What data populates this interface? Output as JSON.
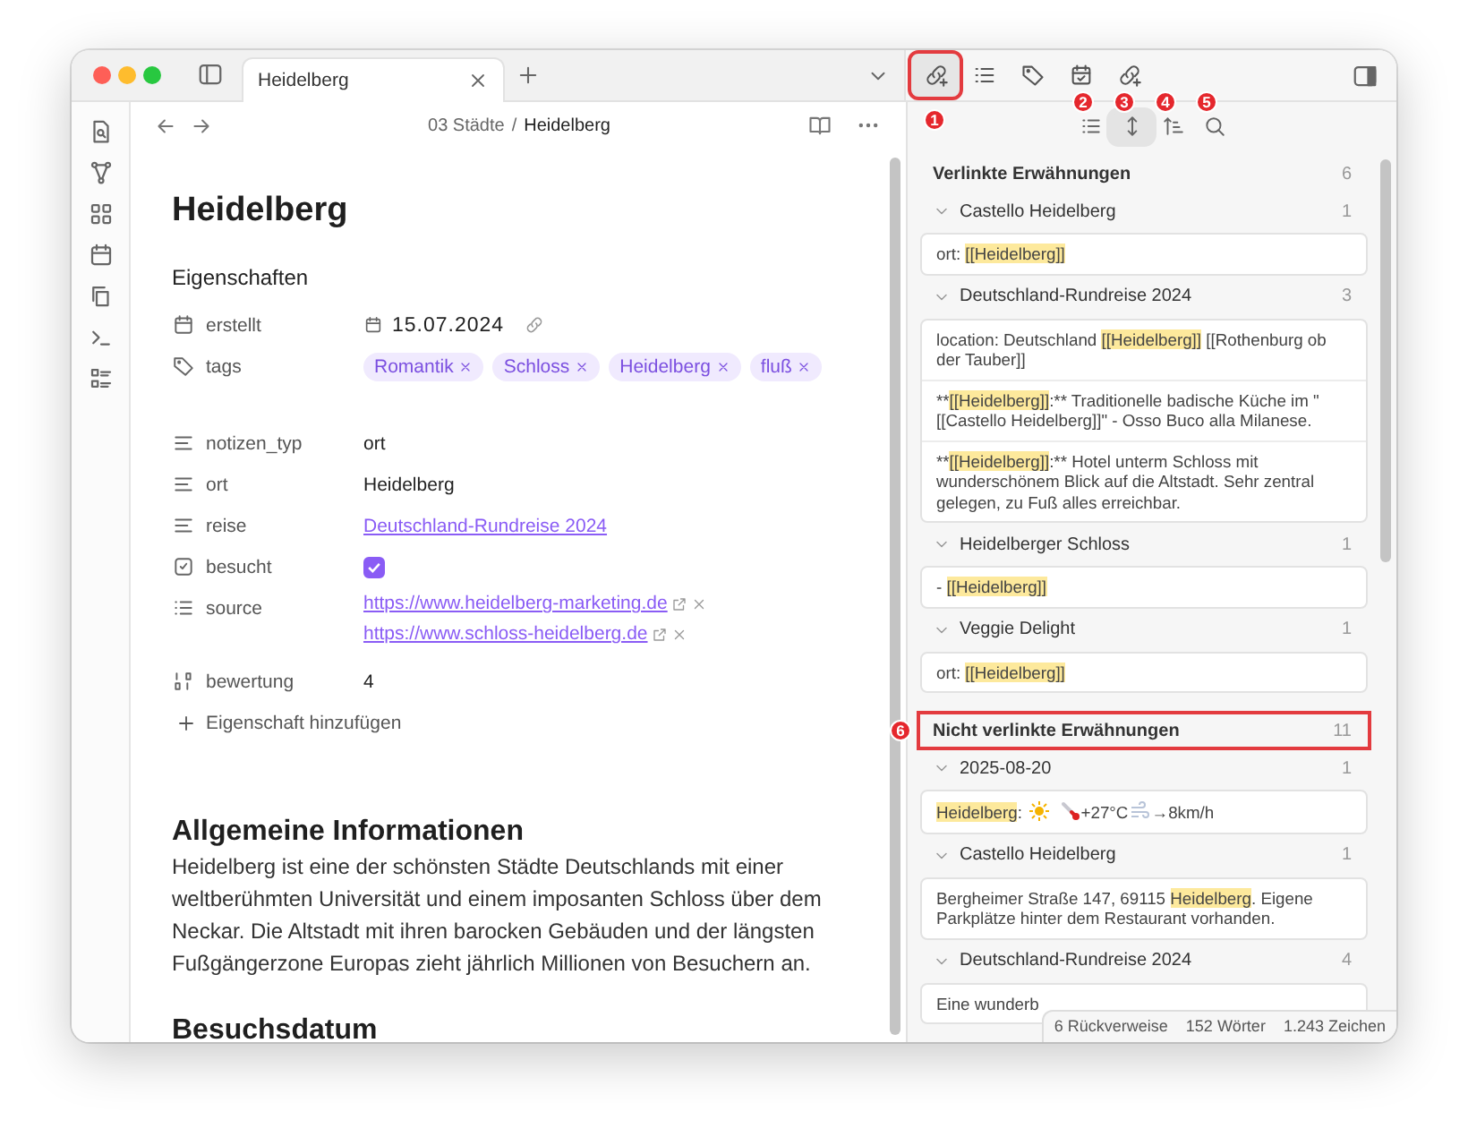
{
  "tab": {
    "title": "Heidelberg",
    "selected": true
  },
  "editor": {
    "breadcrumb": {
      "folder": "03 Städte",
      "separator": "/",
      "note": "Heidelberg"
    },
    "title": "Heidelberg",
    "properties_heading": "Eigenschaften",
    "properties": [
      {
        "kind": "date",
        "label": "erstellt",
        "value": "15.07.2024"
      },
      {
        "kind": "tags",
        "label": "tags",
        "tags": [
          "Romantik",
          "Schloss",
          "Heidelberg",
          "fluß"
        ]
      },
      {
        "kind": "text",
        "label": "notizen_typ",
        "value": "ort"
      },
      {
        "kind": "text",
        "label": "ort",
        "value": "Heidelberg"
      },
      {
        "kind": "link",
        "label": "reise",
        "value": "Deutschland-Rundreise 2024"
      },
      {
        "kind": "checkbox",
        "label": "besucht",
        "checked": true
      },
      {
        "kind": "urls",
        "label": "source",
        "urls": [
          "https://www.heidelberg-marketing.de",
          "https://www.schloss-heidelberg.de"
        ]
      },
      {
        "kind": "number",
        "label": "bewertung",
        "value": "4"
      }
    ],
    "add_property": "Eigenschaft hinzufügen",
    "sections": [
      {
        "heading": "Allgemeine Informationen",
        "body": "Heidelberg ist eine der schönsten Städte Deutschlands mit einer weltberühmten Universität und einem imposanten Schloss über dem Neckar. Die Altstadt mit ihren barocken Gebäuden und der längsten Fußgängerzone Europas zieht jährlich Millionen von Besuchern an."
      },
      {
        "heading": "Besuchsdatum"
      }
    ]
  },
  "panel": {
    "view_tabs": [
      {
        "selected": true,
        "badge": "1",
        "outlined": true
      },
      {
        "selected": false
      },
      {
        "selected": false
      },
      {
        "selected": false
      },
      {
        "selected": false
      }
    ],
    "toolbar": [
      {
        "selected": false,
        "badge": "2"
      },
      {
        "selected": true,
        "badge": "3"
      },
      {
        "selected": false,
        "badge": "4"
      },
      {
        "selected": false,
        "badge": "5"
      }
    ],
    "linked": {
      "title": "Verlinkte Erwähnungen",
      "count": "6",
      "outlined": false,
      "groups": [
        {
          "title": "Castello Heidelberg",
          "count": "1",
          "expanded": true,
          "snippets": [
            [
              {
                "kind": "text",
                "text": "ort: "
              },
              {
                "kind": "highlight",
                "text": "[[Heidelberg]]"
              }
            ]
          ]
        },
        {
          "title": "Deutschland-Rundreise 2024",
          "count": "3",
          "expanded": true,
          "snippets": [
            [
              {
                "kind": "text",
                "text": "location: Deutschland "
              },
              {
                "kind": "highlight",
                "text": "[[Heidelberg]]"
              },
              {
                "kind": "text",
                "text": " [[Rothenburg ob der Tauber]]"
              }
            ],
            [
              {
                "kind": "text",
                "text": "**"
              },
              {
                "kind": "highlight",
                "text": "[[Heidelberg]]"
              },
              {
                "kind": "text",
                "text": ":** Traditionelle badische Küche im \"[[Castello Heidelberg]]\" - Osso Buco alla Milanese."
              }
            ],
            [
              {
                "kind": "text",
                "text": "**"
              },
              {
                "kind": "highlight",
                "text": "[[Heidelberg]]"
              },
              {
                "kind": "text",
                "text": ":** Hotel unterm Schloss mit wunderschönem Blick auf die Altstadt. Sehr zentral gelegen, zu Fuß alles erreichbar."
              }
            ]
          ]
        },
        {
          "title": "Heidelberger Schloss",
          "count": "1",
          "expanded": true,
          "snippets": [
            [
              {
                "kind": "text",
                "text": "- "
              },
              {
                "kind": "highlight",
                "text": "[[Heidelberg]]"
              }
            ]
          ]
        },
        {
          "title": "Veggie Delight",
          "count": "1",
          "expanded": true,
          "snippets": [
            [
              {
                "kind": "text",
                "text": "ort: "
              },
              {
                "kind": "highlight",
                "text": "[[Heidelberg]]"
              }
            ]
          ]
        }
      ]
    },
    "unlinked": {
      "title": "Nicht verlinkte Erwähnungen",
      "count": "11",
      "outlined": true,
      "badge": "6",
      "groups": [
        {
          "title": "2025-08-20",
          "count": "1",
          "expanded": true,
          "snippets": [
            [
              {
                "kind": "highlight",
                "text": "Heidelberg"
              },
              {
                "kind": "text",
                "text": ": "
              },
              {
                "kind": "sun"
              },
              {
                "kind": "thermometer"
              },
              {
                "kind": "text",
                "text": "+27°C"
              },
              {
                "kind": "wind"
              },
              {
                "kind": "text",
                "text": "→8km/h"
              }
            ]
          ]
        },
        {
          "title": "Castello Heidelberg",
          "count": "1",
          "expanded": true,
          "snippets": [
            [
              {
                "kind": "text",
                "text": "Bergheimer Straße 147, 69115 "
              },
              {
                "kind": "highlight",
                "text": "Heidelberg"
              },
              {
                "kind": "text",
                "text": ". Eigene Parkplätze hinter dem Restaurant vorhanden."
              }
            ]
          ]
        },
        {
          "title": "Deutschland-Rundreise 2024",
          "count": "4",
          "expanded": true,
          "snippets": [
            [
              {
                "kind": "text",
                "text": "Eine wunderb"
              }
            ]
          ]
        }
      ]
    }
  },
  "status_bar": [
    "6 Rückverweise",
    "152 Wörter",
    "1.243 Zeichen"
  ]
}
